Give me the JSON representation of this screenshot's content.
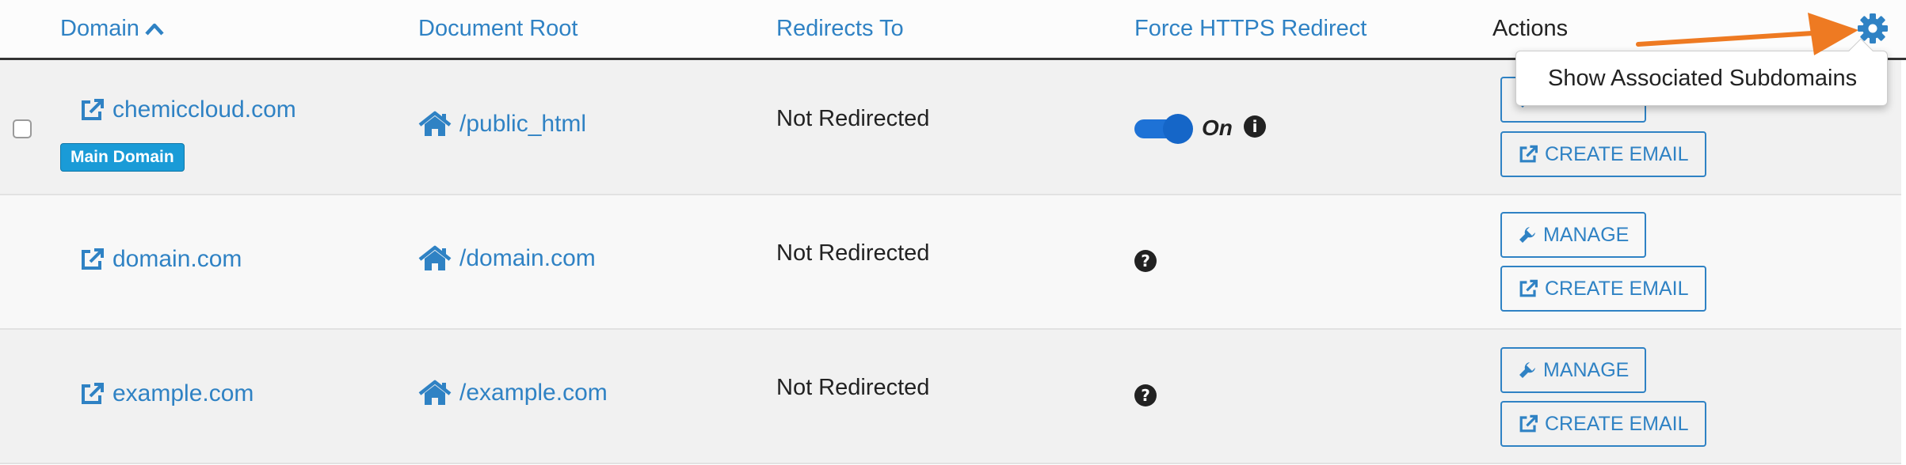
{
  "header": {
    "col_domain": "Domain",
    "col_docroot": "Document Root",
    "col_redirects": "Redirects To",
    "col_https": "Force HTTPS Redirect",
    "col_actions": "Actions"
  },
  "popover": {
    "label": "Show Associated Subdomains"
  },
  "rows": [
    {
      "domain": "chemiccloud.com",
      "badge": "Main Domain",
      "docroot": "/public_html",
      "redirects": "Not Redirected",
      "https": "On",
      "manage": "MANAGE",
      "create_email": "CREATE EMAIL"
    },
    {
      "domain": "domain.com",
      "docroot": "/domain.com",
      "redirects": "Not Redirected",
      "manage": "MANAGE",
      "create_email": "CREATE EMAIL"
    },
    {
      "domain": "example.com",
      "docroot": "/example.com",
      "redirects": "Not Redirected",
      "manage": "MANAGE",
      "create_email": "CREATE EMAIL"
    }
  ],
  "colors": {
    "link": "#2f82c4",
    "badge": "#1a9bd7",
    "toggle": "#1e72d6",
    "arrow": "#ee7a22"
  },
  "icons": [
    "sort-up-icon",
    "external-link-icon",
    "home-icon",
    "info-icon",
    "question-icon",
    "wrench-icon",
    "gear-icon"
  ]
}
